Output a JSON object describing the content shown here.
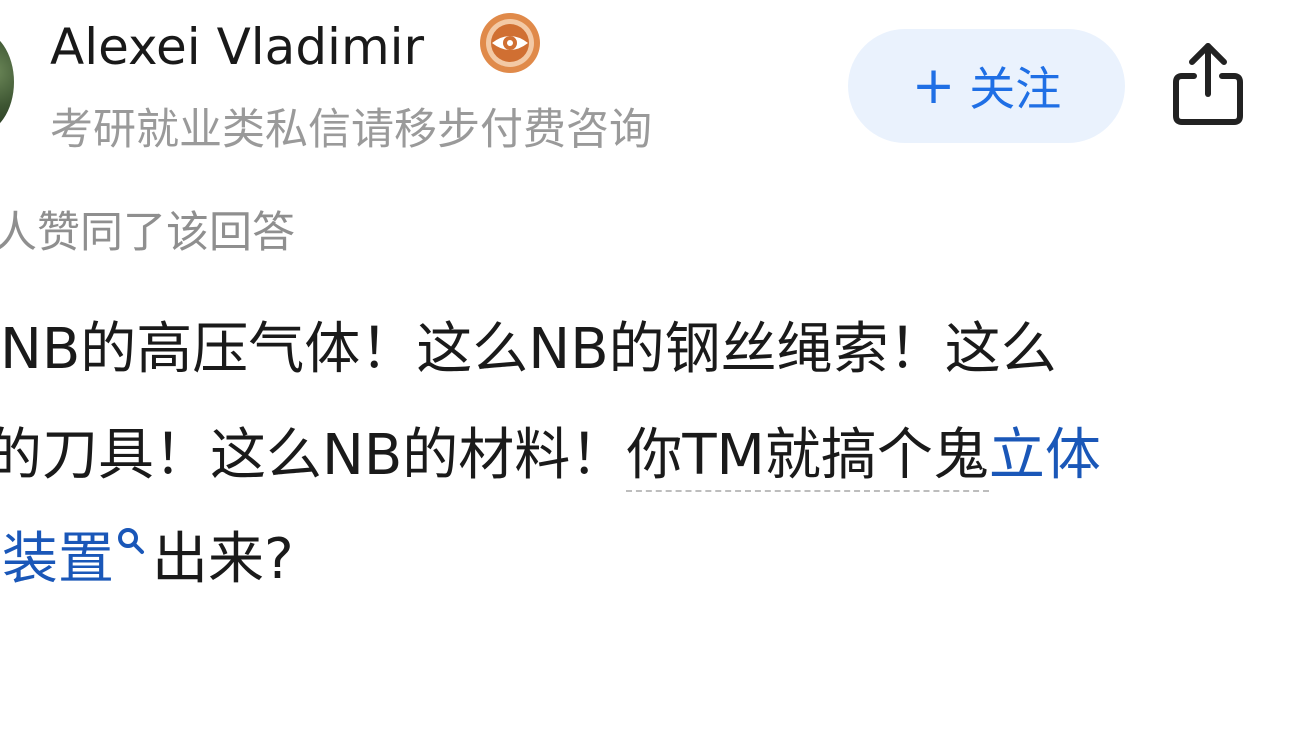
{
  "author": {
    "name": "Alexei Vladimir",
    "bio": "考研就业类私信请移步付费咨询"
  },
  "header": {
    "follow_label": "关注"
  },
  "upvote_meta": "人赞同了该回答",
  "answer": {
    "line1": "NB的高压气体！这么NB的钢丝绳索！这么",
    "line2_a": "的刀具！这么NB的材料！",
    "line2_b": "你TM就搞个鬼",
    "line2_link": "立体",
    "line3_link": "装置",
    "line3_tail": "出来?"
  },
  "colors": {
    "accent": "#1f6fe5",
    "link": "#1a57b8",
    "muted": "#9a9a9a",
    "follow_bg": "#eaf2fd"
  },
  "icons": {
    "badge": "eye-badge-icon",
    "plus": "plus-icon",
    "share": "share-icon",
    "search": "search-icon"
  }
}
